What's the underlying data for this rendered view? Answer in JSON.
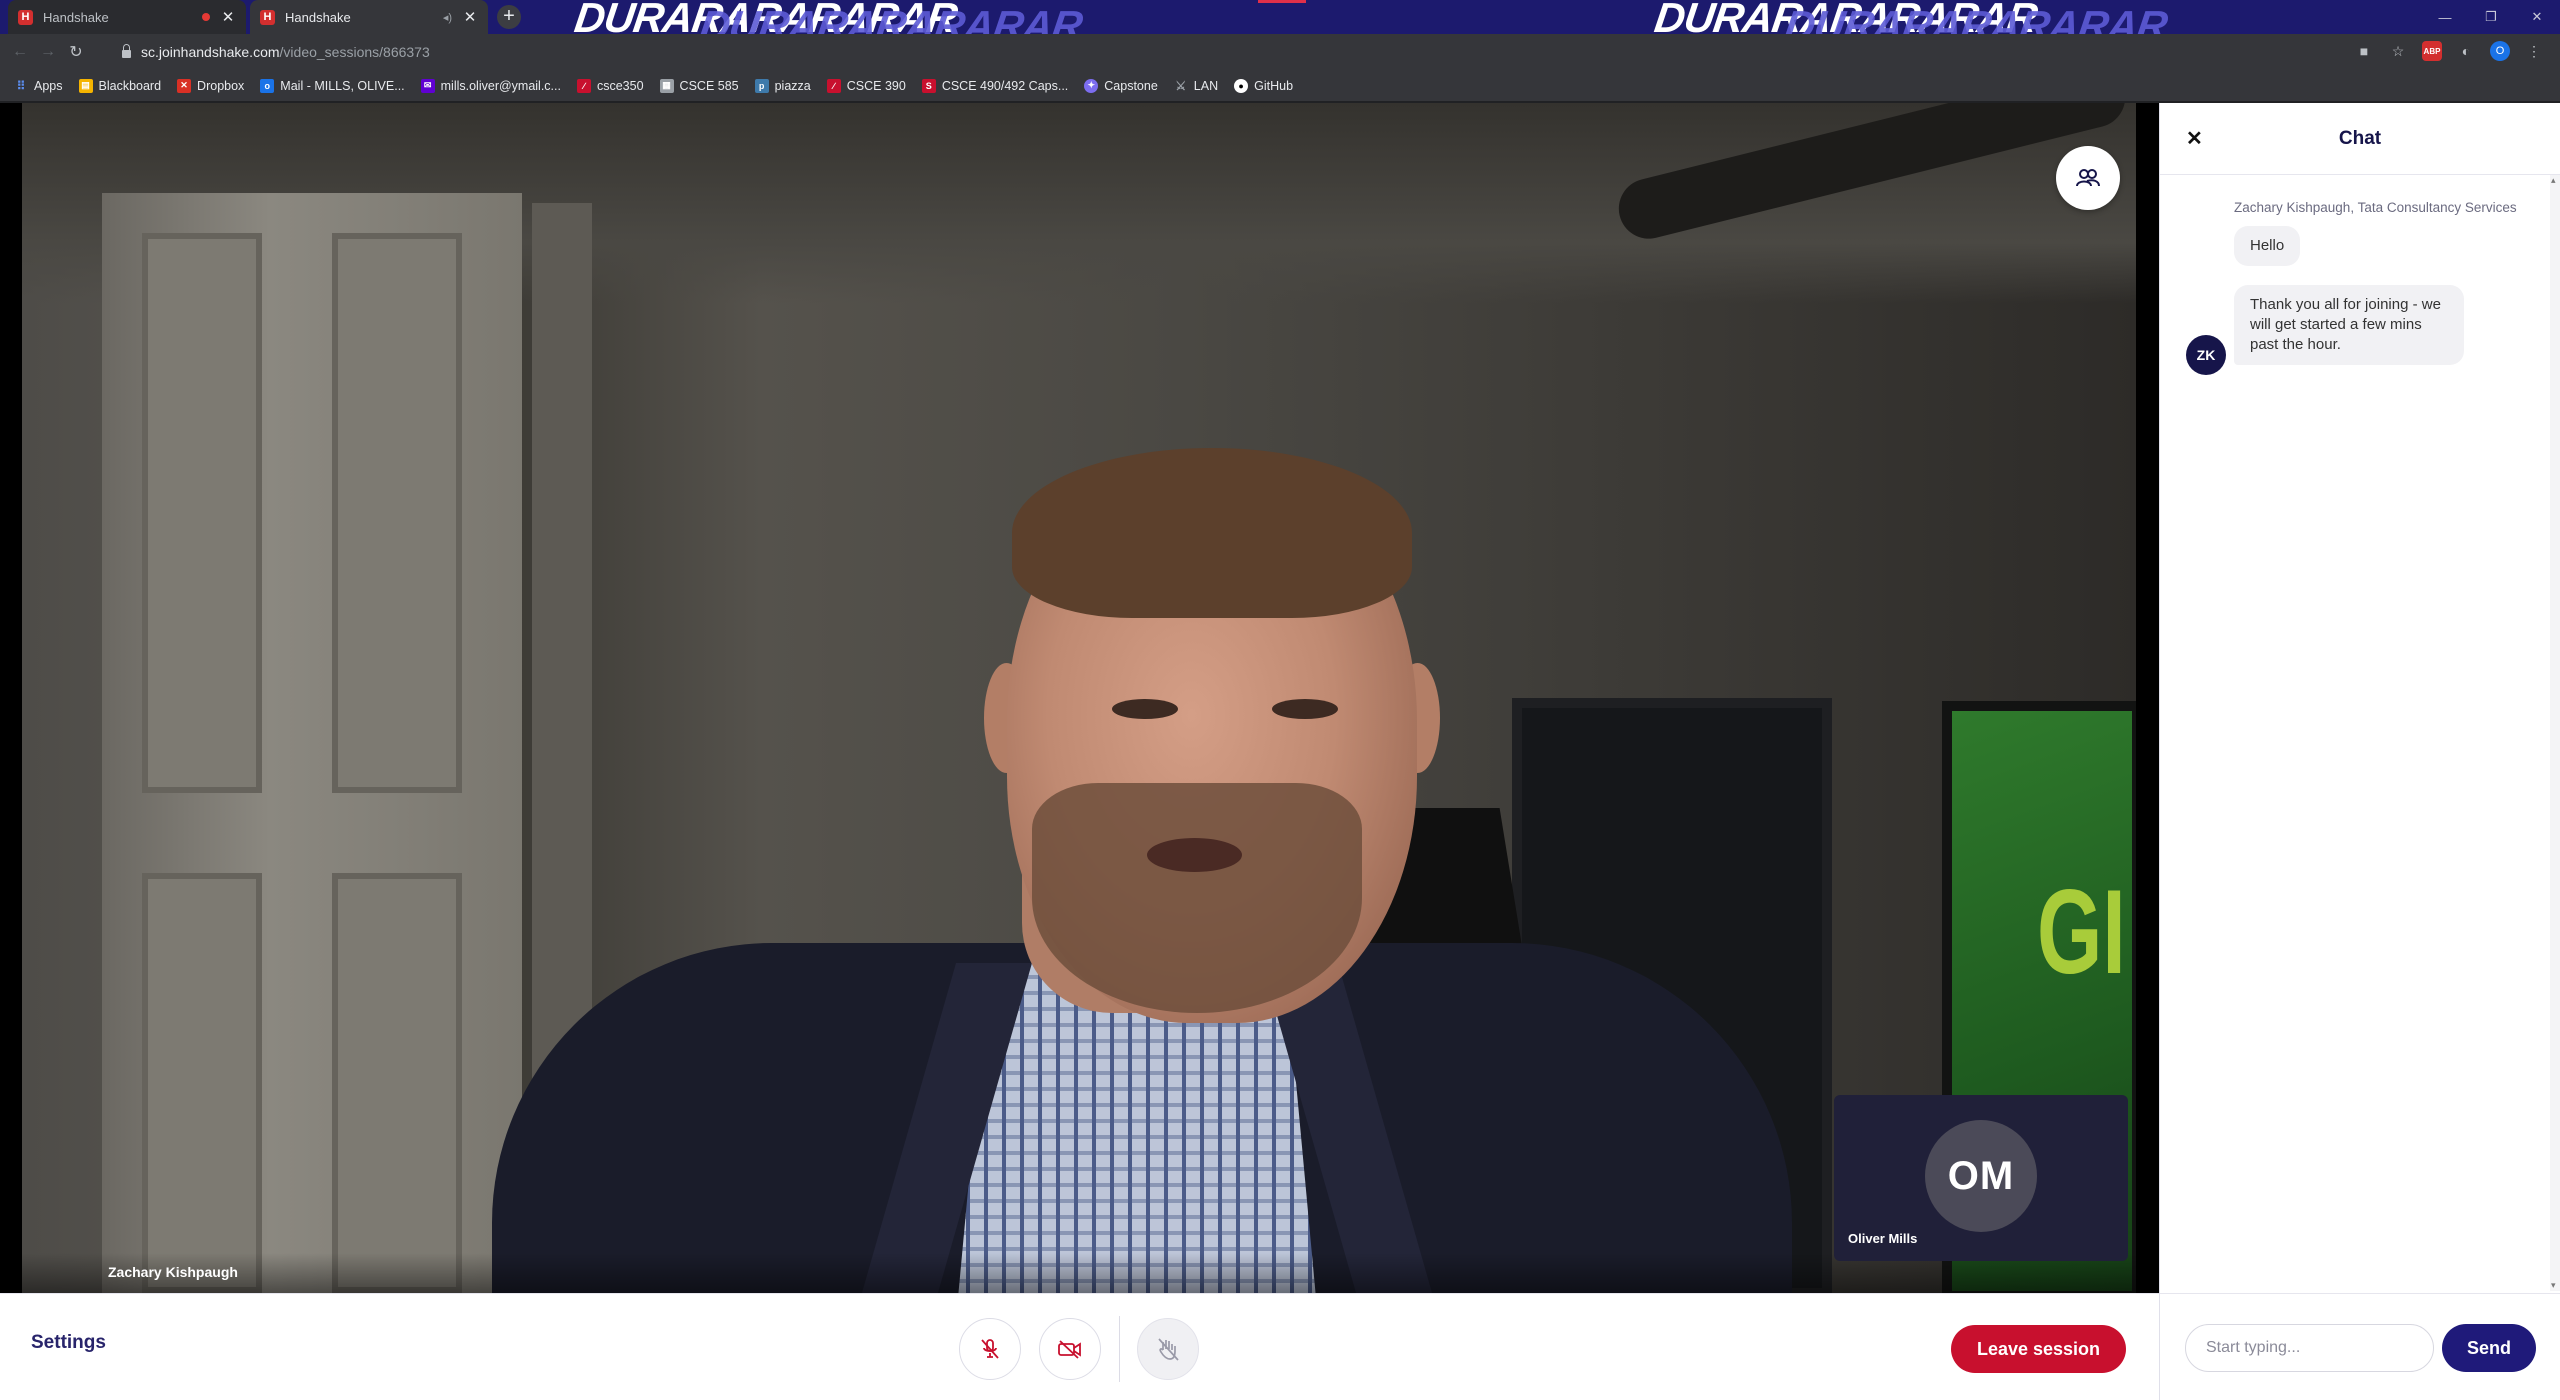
{
  "browser": {
    "tabs": [
      {
        "title": "Handshake",
        "close": "✕"
      },
      {
        "title": "Handshake",
        "close": "✕"
      }
    ],
    "new_tab": "+",
    "theme_text": [
      "DURARARARARAR",
      "DURARARARARAR",
      "DURARARARARAR",
      "DURARARARARAR"
    ],
    "url_host": "sc.joinhandshake.com",
    "url_path": "/video_sessions/866373",
    "profile_initial": "O",
    "abp_label": "ABP",
    "bookmarks": [
      {
        "label": "Apps",
        "icon": "apps-grid-icon",
        "color": "#5b8def"
      },
      {
        "label": "Blackboard",
        "icon": "blackboard-icon",
        "color": "#f5b400"
      },
      {
        "label": "Dropbox",
        "icon": "dropbox-icon",
        "color": "#d93025"
      },
      {
        "label": "Mail - MILLS, OLIVE...",
        "icon": "outlook-icon",
        "color": "#1a73e8"
      },
      {
        "label": "mills.oliver@ymail.c...",
        "icon": "yahoo-mail-icon",
        "color": "#6001d2"
      },
      {
        "label": "csce350",
        "icon": "course-icon",
        "color": "#c8102e"
      },
      {
        "label": "CSCE 585",
        "icon": "page-icon",
        "color": "#9aa0a6"
      },
      {
        "label": "piazza",
        "icon": "piazza-icon",
        "color": "#3e7aab"
      },
      {
        "label": "CSCE 390",
        "icon": "course-icon",
        "color": "#c8102e"
      },
      {
        "label": "CSCE 490/492 Caps...",
        "icon": "scholar-icon",
        "color": "#c8102e"
      },
      {
        "label": "Capstone",
        "icon": "capstone-icon",
        "color": "#7c6df0"
      },
      {
        "label": "LAN",
        "icon": "lan-icon",
        "color": "#9aa0a6"
      },
      {
        "label": "GitHub",
        "icon": "github-icon",
        "color": "#ffffff"
      }
    ]
  },
  "colors": {
    "brand_navy": "#1f1a7a",
    "leave_red": "#c8102e",
    "chat_title": "#16154a",
    "theme_bar": "#1c1a6e"
  },
  "video": {
    "main_participant": "Zachary Kishpaugh",
    "self_participant": "Oliver Mills",
    "self_initials": "OM"
  },
  "controls": {
    "settings_label": "Settings",
    "leave_label": "Leave session"
  },
  "chat": {
    "title": "Chat",
    "close": "✕",
    "sender": "Zachary Kishpaugh, Tata Consultancy Services",
    "sender_initials": "ZK",
    "messages": [
      "Hello",
      "Thank you all for joining - we will get started a few mins past the hour."
    ],
    "input_placeholder": "Start typing...",
    "send_label": "Send"
  }
}
